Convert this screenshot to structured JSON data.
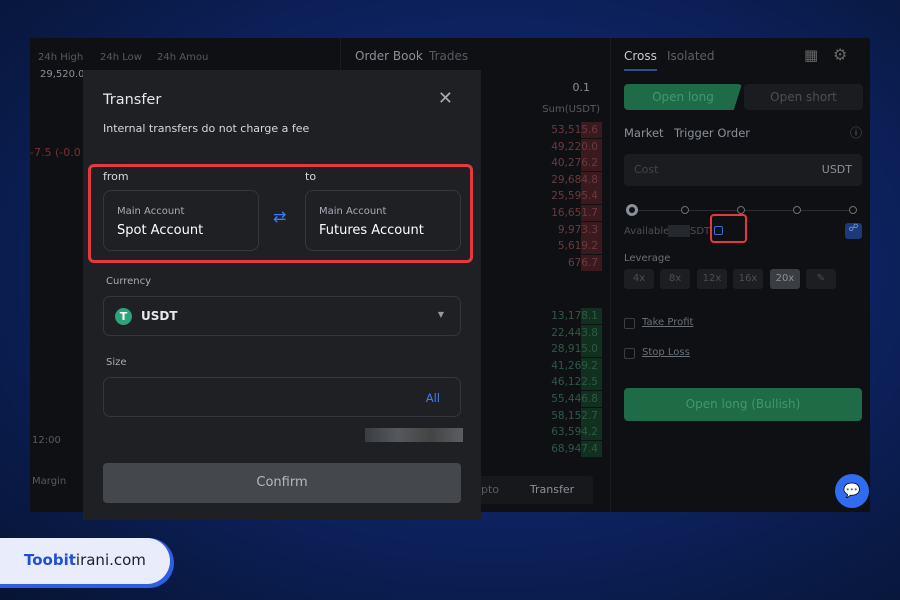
{
  "chart_header": {
    "labels": [
      "24h High",
      "24h Low",
      "24h Amou"
    ],
    "high_value": "29,520.0",
    "change": "-7.5 (-0.0",
    "time_label": "12:00",
    "margin_label": "Margin"
  },
  "order_book": {
    "tabs": [
      "Order Book",
      "Trades"
    ],
    "precision": "0.1",
    "sum_header": "Sum(USDT)",
    "asks": [
      "53,515.6",
      "49,220.0",
      "40,276.2",
      "29,684.8",
      "25,595.4",
      "16,651.7",
      "9,973.3",
      "5,619.2",
      "676.7"
    ],
    "bids": [
      "13,178.1",
      "22,443.8",
      "28,915.0",
      "41,269.2",
      "46,122.5",
      "55,446.8",
      "58,152.7",
      "63,594.2",
      "68,947.4"
    ],
    "bottom_buttons": [
      "pto",
      "Transfer"
    ]
  },
  "trade_panel": {
    "tabs": [
      "Cross",
      "Isolated"
    ],
    "open_long": "Open long",
    "open_short": "Open short",
    "order_types": [
      "Market",
      "Trigger Order"
    ],
    "cost_placeholder": "Cost",
    "cost_unit": "USDT",
    "available_label": "Available",
    "available_unit": "SDT",
    "leverage_label": "Leverage",
    "leverage_options": [
      "4x",
      "8x",
      "12x",
      "16x",
      "20x"
    ],
    "leverage_selected": "20x",
    "take_profit": "Take Profit",
    "stop_loss": "Stop Loss",
    "submit": "Open long (Bullish)",
    "slider_percent": 0
  },
  "modal": {
    "title": "Transfer",
    "subtitle": "Internal transfers do not charge a fee",
    "from_label": "from",
    "to_label": "to",
    "from": {
      "sub": "Main Account",
      "name": "Spot Account"
    },
    "to": {
      "sub": "Main Account",
      "name": "Futures Account"
    },
    "currency_label": "Currency",
    "currency": "USDT",
    "size_label": "Size",
    "size_placeholder": "",
    "all_label": "All",
    "confirm": "Confirm"
  },
  "brand": {
    "bold": "Toobit",
    "rest": "irani.com"
  },
  "colors": {
    "green": "#1f7a52",
    "highlight": "#e53940",
    "accent": "#3b7cff"
  }
}
